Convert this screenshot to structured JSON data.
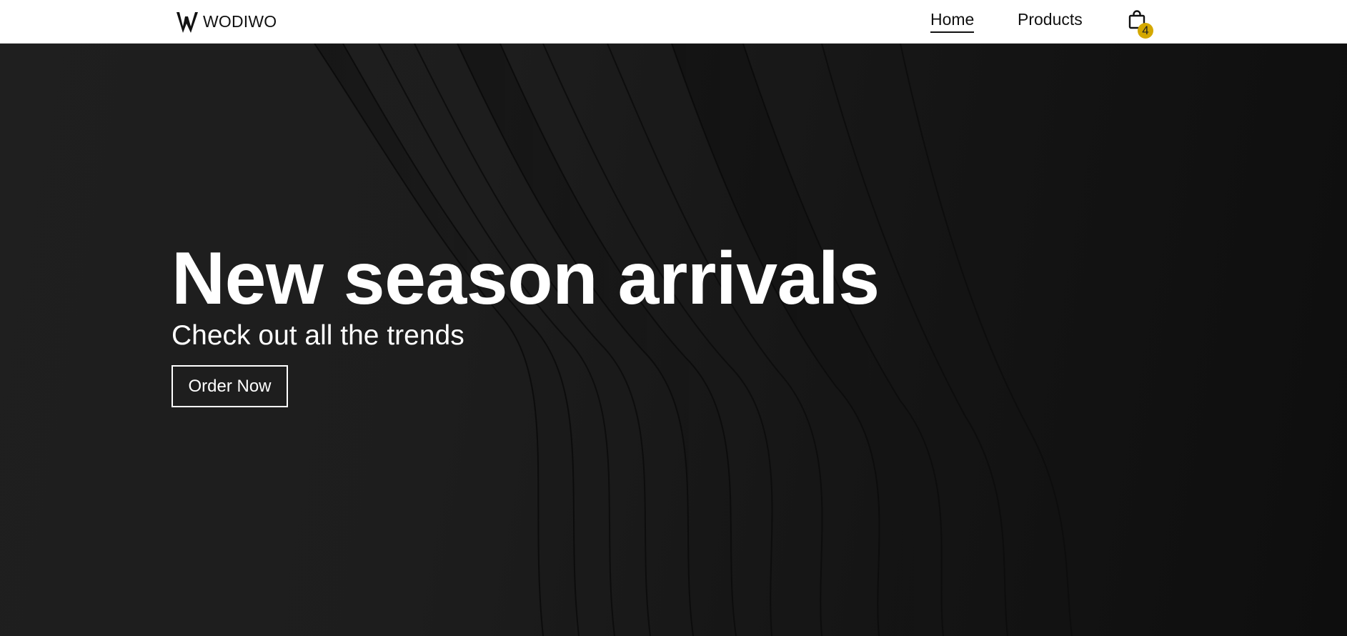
{
  "nav": {
    "brand_name": "WODIWO",
    "links": [
      {
        "label": "Home",
        "active": true
      },
      {
        "label": "Products",
        "active": false
      }
    ],
    "cart_count": "4"
  },
  "hero": {
    "title": "New season arrivals",
    "subtitle": "Check out all the trends",
    "button_label": "Order Now"
  },
  "colors": {
    "nav_background": "#ffffff",
    "hero_background": "#1c1c1c",
    "badge": "#d4a800",
    "text_on_dark": "#ffffff"
  },
  "icons": {
    "brand": "w-logo-icon",
    "cart": "shopping-bag-icon"
  }
}
